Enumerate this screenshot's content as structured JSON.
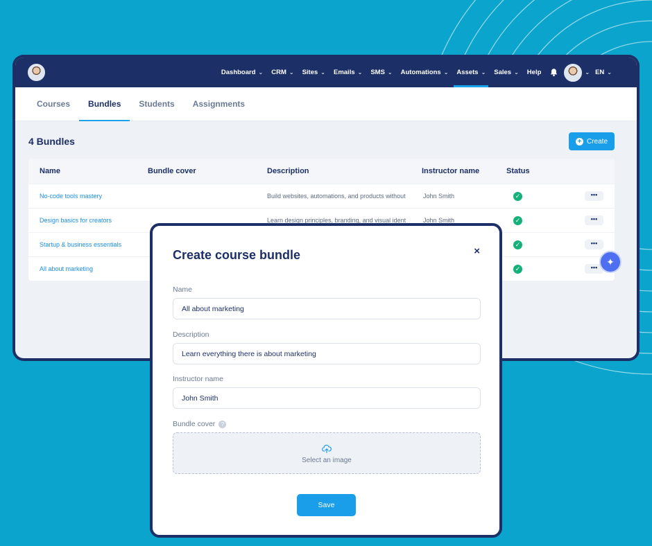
{
  "nav": {
    "menu": [
      {
        "label": "Dashboard",
        "chevron": true
      },
      {
        "label": "CRM",
        "chevron": true
      },
      {
        "label": "Sites",
        "chevron": true
      },
      {
        "label": "Emails",
        "chevron": true
      },
      {
        "label": "SMS",
        "chevron": true
      },
      {
        "label": "Automations",
        "chevron": true
      },
      {
        "label": "Assets",
        "chevron": true,
        "active": true
      },
      {
        "label": "Sales",
        "chevron": true
      },
      {
        "label": "Help",
        "chevron": false
      }
    ],
    "language": "EN"
  },
  "tabs": [
    {
      "label": "Courses",
      "active": false
    },
    {
      "label": "Bundles",
      "active": true
    },
    {
      "label": "Students",
      "active": false
    },
    {
      "label": "Assignments",
      "active": false
    }
  ],
  "page": {
    "title": "4 Bundles",
    "create_label": "Create"
  },
  "table": {
    "headers": {
      "name": "Name",
      "cover": "Bundle cover",
      "description": "Description",
      "instructor": "Instructor name",
      "status": "Status"
    },
    "rows": [
      {
        "name": "No-code tools mastery",
        "description": "Build websites, automations, and products without",
        "instructor": "John Smith",
        "status": "active"
      },
      {
        "name": "Design basics for creators",
        "description": "Learn design principles, branding, and visual ident",
        "instructor": "John Smith",
        "status": "active"
      },
      {
        "name": "Startup & business essentials",
        "description": "",
        "instructor": "",
        "status": "active"
      },
      {
        "name": "All about marketing",
        "description": "",
        "instructor": "",
        "status": "active"
      }
    ]
  },
  "modal": {
    "title": "Create course bundle",
    "close": "×",
    "name_label": "Name",
    "name_value": "All about marketing",
    "description_label": "Description",
    "description_value": "Learn everything there is about marketing",
    "instructor_label": "Instructor name",
    "instructor_value": "John Smith",
    "cover_label": "Bundle cover",
    "cover_help": "?",
    "dropzone_text": "Select an image",
    "save_label": "Save"
  },
  "icons": {
    "bell": "bell-icon",
    "chevron": "chevron-down-icon",
    "check": "check-circle-icon",
    "more": "more-horizontal-icon",
    "upload": "upload-cloud-icon",
    "ai": "sparkle-icon"
  },
  "colors": {
    "background": "#0aa4cc",
    "navy": "#1c2f66",
    "accent": "#1a9eea",
    "success": "#16b07a"
  }
}
